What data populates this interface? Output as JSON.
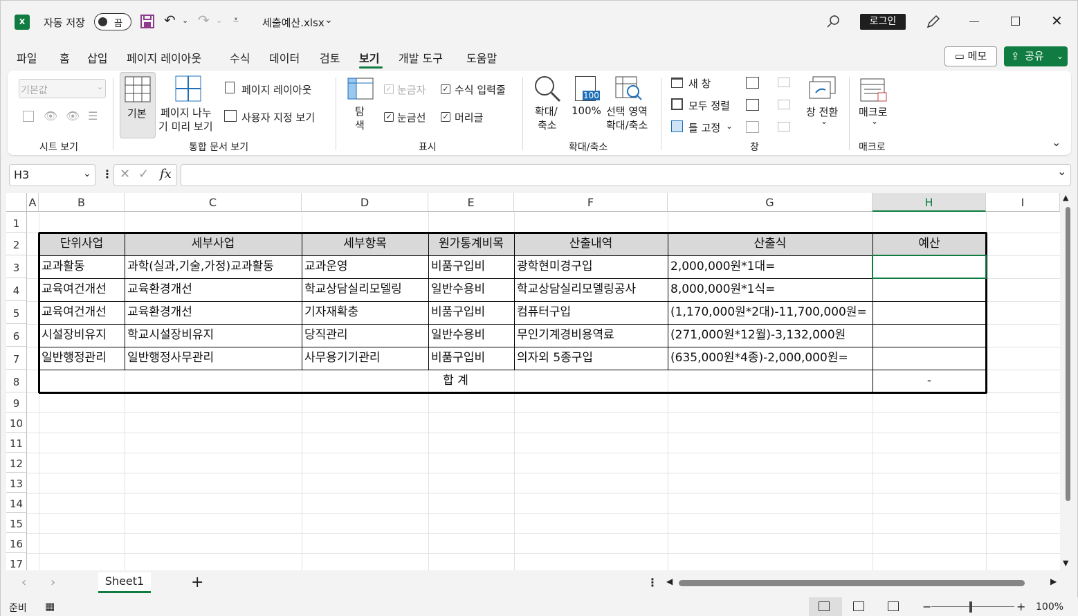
{
  "title_bar": {
    "autosave_label": "자동 저장",
    "autosave_state": "끔",
    "filename": "세출예산.xlsx",
    "login_label": "로그인"
  },
  "menu": {
    "items": [
      "파일",
      "홈",
      "삽입",
      "페이지 레이아웃",
      "수식",
      "데이터",
      "검토",
      "보기",
      "개발 도구",
      "도움말"
    ],
    "active": "보기",
    "memo_label": "메모",
    "share_label": "공유"
  },
  "ribbon": {
    "sheet_view": {
      "dropdown_value": "기본값",
      "group_label": "시트 보기"
    },
    "workbook_views": {
      "normal": "기본",
      "page_break_line1": "페이지 나누",
      "page_break_line2": "기 미리 보기",
      "page_layout": "페이지 레이아웃",
      "custom_views": "사용자 지정 보기",
      "group_label": "통합 문서 보기"
    },
    "show": {
      "navigation_line1": "탐",
      "navigation_line2": "색",
      "ruler": "눈금자",
      "formula_bar": "수식 입력줄",
      "gridlines": "눈금선",
      "headings": "머리글",
      "group_label": "표시"
    },
    "zoom": {
      "zoom_line1": "확대/",
      "zoom_line2": "축소",
      "hundred": "100%",
      "hundred_icon_text": "100",
      "selection_line1": "선택 영역",
      "selection_line2": "확대/축소",
      "group_label": "확대/축소"
    },
    "window": {
      "new_window": "새 창",
      "arrange_all": "모두 정렬",
      "freeze_panes": "틀 고정",
      "switch_windows": "창 전환",
      "group_label": "창"
    },
    "macros": {
      "macros": "매크로",
      "group_label": "매크로"
    }
  },
  "formula_bar": {
    "name_box": "H3",
    "fx_label": "fx",
    "formula": ""
  },
  "columns": [
    "A",
    "B",
    "C",
    "D",
    "E",
    "F",
    "G",
    "H",
    "I"
  ],
  "selected_column": "H",
  "rows": [
    "1",
    "2",
    "3",
    "4",
    "5",
    "6",
    "7",
    "8",
    "9",
    "10",
    "11",
    "12",
    "13",
    "14",
    "15",
    "16",
    "17"
  ],
  "table": {
    "headers": [
      "단위사업",
      "세부사업",
      "세부항목",
      "원가통계비목",
      "산출내역",
      "산출식",
      "예산"
    ],
    "rows": [
      [
        "교과활동",
        "과학(실과,기술,가정)교과활동",
        "교과운영",
        "비품구입비",
        "광학현미경구입",
        "2,000,000원*1대=",
        ""
      ],
      [
        "교육여건개선",
        "교육환경개선",
        "학교상담실리모델링",
        "일반수용비",
        "학교상담실리모델링공사",
        "8,000,000원*1식=",
        ""
      ],
      [
        "교육여건개선",
        "교육환경개선",
        "기자재확충",
        "비품구입비",
        "컴퓨터구입",
        "(1,170,000원*2대)-11,700,000원=",
        ""
      ],
      [
        "시설장비유지",
        "학교시설장비유지",
        "당직관리",
        "일반수용비",
        "무인기계경비용역료",
        "(271,000원*12월)-3,132,000원",
        ""
      ],
      [
        "일반행정관리",
        "일반행정사무관리",
        "사무용기기관리",
        "비품구입비",
        "의자외 5종구입",
        "(635,000원*4종)-2,000,000원=",
        ""
      ]
    ],
    "total_label": "합 계",
    "total_value": "-"
  },
  "sheet_tabs": {
    "active": "Sheet1",
    "add_label": "+"
  },
  "status": {
    "ready": "준비",
    "zoom": "100%",
    "zoom_minus": "−",
    "zoom_plus": "+"
  }
}
